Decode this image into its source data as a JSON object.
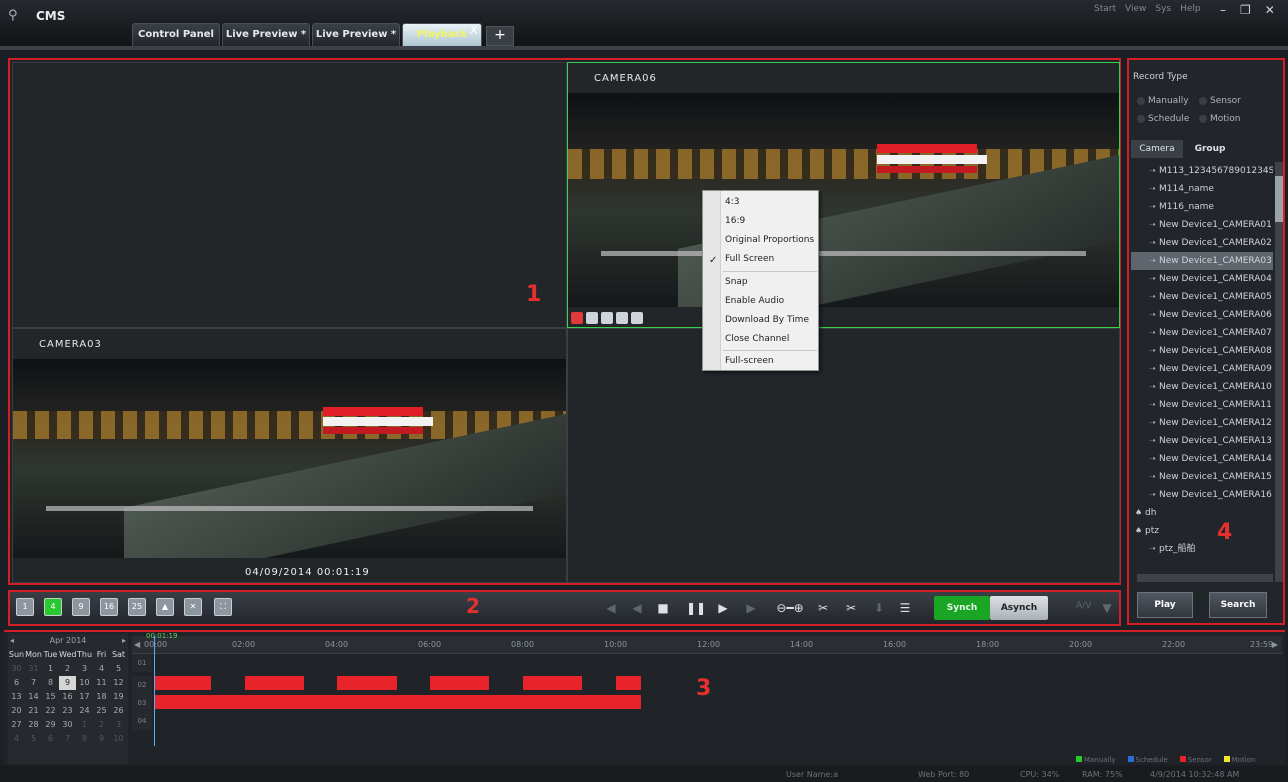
{
  "app": {
    "title": "CMS"
  },
  "topmenu": [
    "Start",
    "View",
    "Sys",
    "Help"
  ],
  "tabs": [
    {
      "label": "Control Panel"
    },
    {
      "label": "Live Preview *"
    },
    {
      "label": "Live Preview *"
    },
    {
      "label": "Playback"
    }
  ],
  "tab_close": "X",
  "tab_add": "+",
  "video": {
    "cells": [
      {
        "camera": ""
      },
      {
        "camera": "CAMERA06"
      },
      {
        "camera": "CAMERA03",
        "timestamp": "04/09/2014 00:01:19"
      },
      {
        "camera": ""
      }
    ],
    "area_number": "1"
  },
  "context_menu": [
    "4:3",
    "16:9",
    "Original Proportions",
    "Full Screen",
    "Snap",
    "Enable Audio",
    "Download By Time",
    "Close Channel",
    "Full-screen"
  ],
  "control_bar": {
    "layouts": [
      "1",
      "4",
      "9",
      "16",
      "25"
    ],
    "area_number": "2",
    "synch": "Synch",
    "asynch": "Asynch",
    "dim_label": "A/V"
  },
  "right_panel": {
    "record_type": "Record Type",
    "radios": [
      "Manually",
      "Sensor",
      "Schedule",
      "Motion"
    ],
    "tabs": [
      "Camera",
      "Group"
    ],
    "tree": [
      "M113_12345678901234S",
      "M114_name",
      "M116_name",
      "New Device1_CAMERA01",
      "New Device1_CAMERA02",
      "New Device1_CAMERA03",
      "New Device1_CAMERA04",
      "New Device1_CAMERA05",
      "New Device1_CAMERA06",
      "New Device1_CAMERA07",
      "New Device1_CAMERA08",
      "New Device1_CAMERA09",
      "New Device1_CAMERA10",
      "New Device1_CAMERA11",
      "New Device1_CAMERA12",
      "New Device1_CAMERA13",
      "New Device1_CAMERA14",
      "New Device1_CAMERA15",
      "New Device1_CAMERA16",
      "dh",
      "ptz",
      "ptz_船舶"
    ],
    "area_number": "4",
    "play": "Play",
    "search": "Search"
  },
  "calendar": {
    "month": "Apr  2014",
    "days": [
      "Sun",
      "Mon",
      "Tue",
      "Wed",
      "Thu",
      "Fri",
      "Sat"
    ],
    "weeks": [
      [
        "30",
        "31",
        "1",
        "2",
        "3",
        "4",
        "5"
      ],
      [
        "6",
        "7",
        "8",
        "9",
        "10",
        "11",
        "12"
      ],
      [
        "13",
        "14",
        "15",
        "16",
        "17",
        "18",
        "19"
      ],
      [
        "20",
        "21",
        "22",
        "23",
        "24",
        "25",
        "26"
      ],
      [
        "27",
        "28",
        "29",
        "30",
        "1",
        "2",
        "3"
      ],
      [
        "4",
        "5",
        "6",
        "7",
        "8",
        "9",
        "10"
      ]
    ]
  },
  "timeline": {
    "current": "00:01:19",
    "ticks": [
      "00:00",
      "02:00",
      "04:00",
      "06:00",
      "08:00",
      "10:00",
      "12:00",
      "14:00",
      "16:00",
      "18:00",
      "20:00",
      "22:00",
      "23:59"
    ],
    "rows": [
      "01",
      "02",
      "03",
      "04"
    ],
    "area_number": "3"
  },
  "legend": [
    "Manually",
    "Schedule",
    "Sensor",
    "Motion"
  ],
  "status": {
    "user": "User Name:a",
    "port": "Web Port: 80",
    "cpu": "CPU: 34%",
    "ram": "RAM: 75%",
    "time": "4/9/2014 10:32:48 AM"
  }
}
